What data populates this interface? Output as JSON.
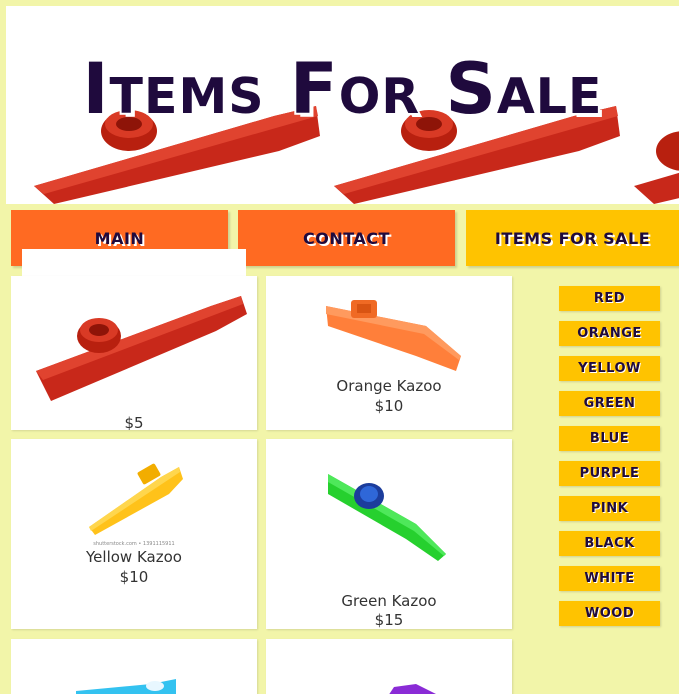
{
  "banner": {
    "title": "Items For Sale"
  },
  "nav": {
    "main": "MAIN",
    "contact": "CONTACT",
    "items": "ITEMS FOR SALE"
  },
  "products": [
    {
      "name": "",
      "price": "$5",
      "color": "#c8281a"
    },
    {
      "name": "Orange Kazoo",
      "price": "$10",
      "color": "#ff7f3a"
    },
    {
      "name": "Yellow Kazoo",
      "price": "$10",
      "color": "#ffc21a",
      "note": "shutterstock.com • 1391115911"
    },
    {
      "name": "Green Kazoo",
      "price": "$15",
      "color": "#26d02e"
    },
    {
      "name": "",
      "price": "",
      "color": "#33c2f0"
    },
    {
      "name": "",
      "price": "",
      "color": "#8a2bd6"
    }
  ],
  "filters": [
    "RED",
    "ORANGE",
    "YELLOW",
    "GREEN",
    "BLUE",
    "PURPLE",
    "PINK",
    "BLACK",
    "WHITE",
    "WOOD"
  ],
  "colors": {
    "background": "#f2f5a9",
    "nav_orange": "#ff6a22",
    "nav_active": "#ffc300",
    "title": "#1f0a3d"
  }
}
